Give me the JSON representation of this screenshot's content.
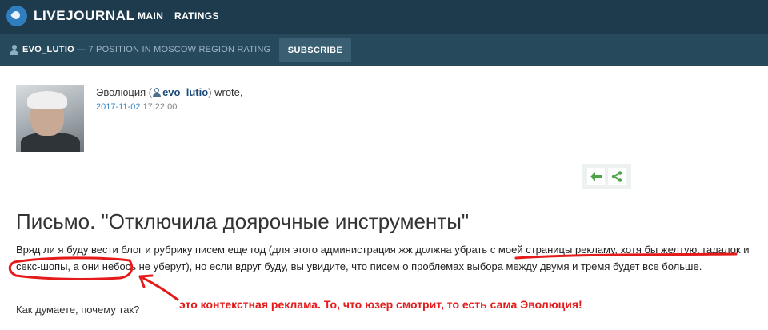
{
  "header": {
    "logo_text": "LIVEJOURNAL",
    "nav": [
      {
        "label": "MAIN"
      },
      {
        "label": "RATINGS"
      }
    ]
  },
  "userbar": {
    "username": "EVO_LUTIO",
    "rating_text": "— 7 POSITION IN MOSCOW REGION RATING",
    "subscribe_label": "SUBSCRIBE"
  },
  "author": {
    "name_prefix": "Эволюция (",
    "username": "evo_lutio",
    "name_suffix": ") wrote,",
    "date": "2017-11-02",
    "time": "17:22:00"
  },
  "post": {
    "title": "Письмо. \"Отключила доярочные инструменты\"",
    "body": "Вряд ли я буду вести блог и рубрику писем еще год (для этого администрация жж должна убрать с моей страницы рекламу, хотя бы желтую, гадалок и секс-шопы, а они небось не уберут), но если вдруг буду, вы увидите, что писем о проблемах выбора между двумя и тремя будет все больше.",
    "question": "Как думаете, почему так?"
  },
  "share": {
    "icons": [
      "back-arrow-icon",
      "share-icon"
    ]
  },
  "annotation": {
    "text": "это контекстная реклама. То, что юзер смотрит, то есть сама Эволюция!",
    "color": "#e51b1b"
  },
  "colors": {
    "topbar": "#1e3b4d",
    "userbar": "#27495c",
    "accent": "#3b89c4",
    "share_green": "#4ea547"
  }
}
